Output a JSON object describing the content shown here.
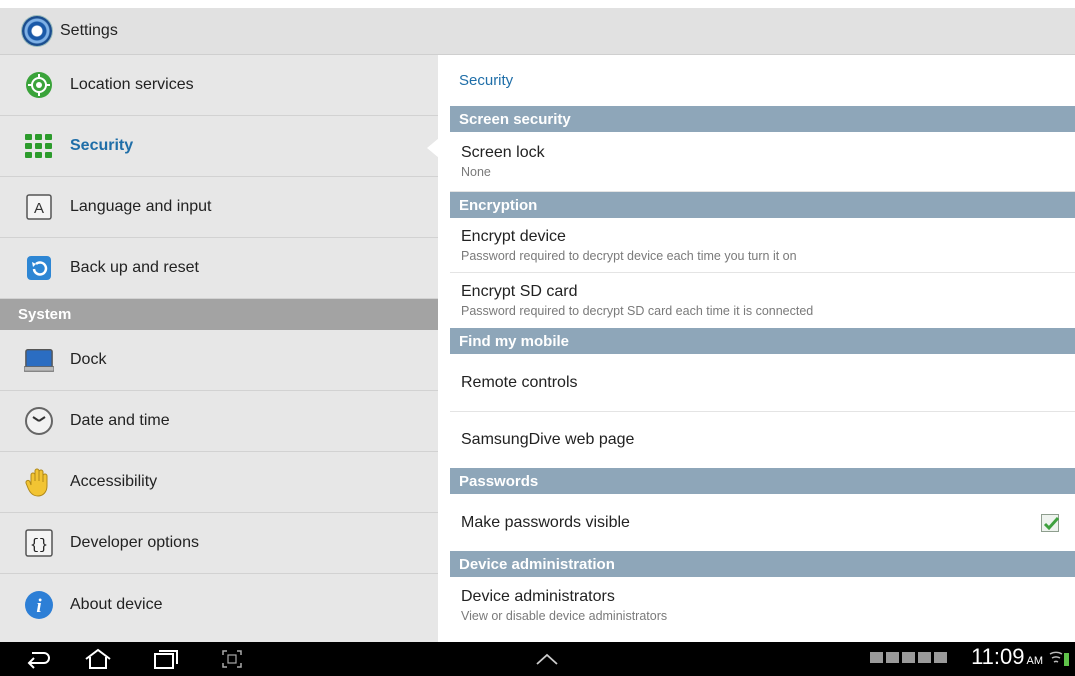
{
  "app": {
    "title": "Settings"
  },
  "left_nav": {
    "items_before": [
      {
        "label": "Location services",
        "icon": "location-icon"
      },
      {
        "label": "Security",
        "icon": "security-icon",
        "active": true
      },
      {
        "label": "Language and input",
        "icon": "language-icon"
      },
      {
        "label": "Back up and reset",
        "icon": "backup-icon"
      }
    ],
    "section_header": "System",
    "items_after": [
      {
        "label": "Dock",
        "icon": "dock-icon"
      },
      {
        "label": "Date and time",
        "icon": "clock-icon"
      },
      {
        "label": "Accessibility",
        "icon": "hand-icon"
      },
      {
        "label": "Developer options",
        "icon": "braces-icon"
      },
      {
        "label": "About device",
        "icon": "info-icon"
      }
    ]
  },
  "detail": {
    "title": "Security",
    "sections": [
      {
        "header": "Screen security",
        "items": [
          {
            "title": "Screen lock",
            "subtitle": "None"
          }
        ]
      },
      {
        "header": "Encryption",
        "items": [
          {
            "title": "Encrypt device",
            "subtitle": "Password required to decrypt device each time you turn it on"
          },
          {
            "title": "Encrypt SD card",
            "subtitle": "Password required to decrypt SD card each time it is connected"
          }
        ]
      },
      {
        "header": "Find my mobile",
        "items": [
          {
            "title": "Remote controls"
          },
          {
            "title": "SamsungDive web page"
          }
        ]
      },
      {
        "header": "Passwords",
        "items": [
          {
            "title": "Make passwords visible",
            "checked": true
          }
        ]
      },
      {
        "header": "Device administration",
        "items": [
          {
            "title": "Device administrators",
            "subtitle": "View or disable device administrators"
          }
        ]
      }
    ]
  },
  "navbar": {
    "time": "11:09",
    "ampm": "AM",
    "icons": [
      "back-icon",
      "home-icon",
      "recent-apps-icon",
      "screenshot-icon",
      "chevron-up-icon"
    ]
  },
  "colors": {
    "accent": "#1f6ea8",
    "section_header": "#8ea6b9",
    "left_header": "#a3a3a3"
  }
}
